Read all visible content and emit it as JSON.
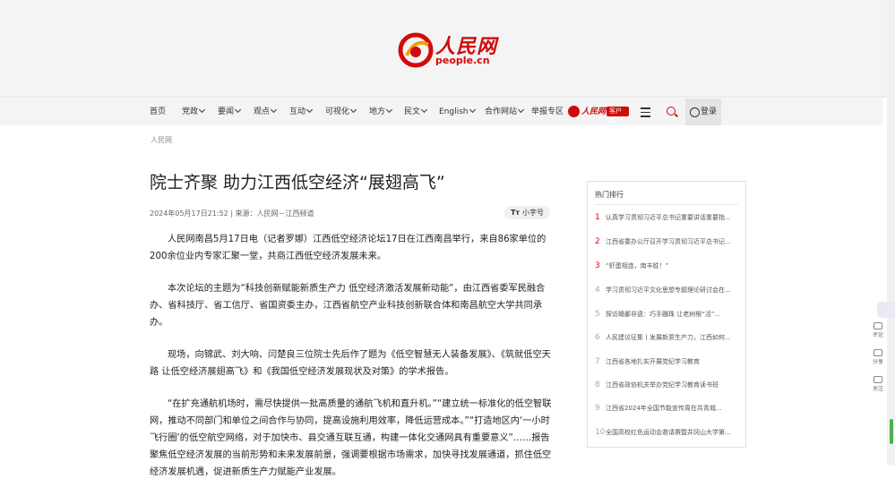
{
  "logo": {
    "cn": "人民网",
    "en": "people.cn"
  },
  "nav": {
    "items": [
      {
        "label": "首页",
        "caret": false
      },
      {
        "label": "党政",
        "caret": true
      },
      {
        "label": "要闻",
        "caret": true
      },
      {
        "label": "观点",
        "caret": true
      },
      {
        "label": "互动",
        "caret": true
      },
      {
        "label": "可视化",
        "caret": true
      },
      {
        "label": "地方",
        "caret": true
      },
      {
        "label": "民文",
        "caret": true
      },
      {
        "label": "English",
        "caret": true
      },
      {
        "label": "合作网站",
        "caret": true
      },
      {
        "label": "举报专区",
        "caret": false
      }
    ],
    "app_name": "人民网+",
    "app_tag": "客户端",
    "login": "登录"
  },
  "breadcrumb": "人民网",
  "article": {
    "title": "院士齐聚 助力江西低空经济“展翅高飞”",
    "meta": "2024年05月17日21:52 | 来源：人民网－江西频道",
    "fontsize_label": "小字号",
    "paragraphs": [
      "人民网南昌5月17日电（记者罗娜）江西低空经济论坛17日在江西南昌举行，来自86家单位的200余位业内专家汇聚一堂，共商江西低空经济发展未来。",
      "本次论坛的主题为“科技创新赋能新质生产力 低空经济激活发展新动能”，由江西省委军民融合办、省科技厅、省工信厅、省国资委主办，江西省航空产业科技创新联合体和南昌航空大学共同承办。",
      "现场，向锦武、刘大响、闫楚良三位院士先后作了题为《低空智慧无人装备发展》、《筑就低空天路 让低空经济展翅高飞》和《我国低空经济发展现状及对策》的学术报告。",
      "“在扩充通航机场时，需尽快提供一批高质量的通航飞机和直升机。”“建立统一标准化的低空智联网，推动不同部门和单位之间合作与协同，提高设施利用效率，降低运营成本。”“打造地区内‘一小时飞行圈’的低空航空网络，对于加快市、县交通互联互通，构建一体化交通网具有重要意义”……报告聚焦低空经济发展的当前形势和未来发展前景，强调要根据市场需求，加快寻找发展通道，抓住低空经济发展机遇，促进新质生产力赋能产业发展。"
    ]
  },
  "hot": {
    "title": "热门排行",
    "items": [
      {
        "num": "1",
        "text": "认真学习贯彻习近平总书记重要讲话重要指..."
      },
      {
        "num": "2",
        "text": "江西省委办公厅召开学习贯彻习近平总书记..."
      },
      {
        "num": "3",
        "text": "“虾蛋相连，南丰胜！”"
      },
      {
        "num": "4",
        "text": "学习贯彻习近平文化思想专题理论研讨会在..."
      },
      {
        "num": "5",
        "text": "探访赣鄱非遗：巧手蹦珠 让老树根“活”..."
      },
      {
        "num": "6",
        "text": "人民建议征集丨发展新质生产力，江西如何..."
      },
      {
        "num": "7",
        "text": "江西省各地扎实开展党纪学习教育"
      },
      {
        "num": "8",
        "text": "江西省政协机关举办党纪学习教育读书班"
      },
      {
        "num": "9",
        "text": "江西省2024年全国节能宣传周在共青城..."
      },
      {
        "num": "10",
        "text": "全国高校红色运动会邀请赛暨井冈山大学第..."
      }
    ]
  },
  "side_tools": [
    {
      "label": "评论"
    },
    {
      "label": "分享"
    },
    {
      "label": "关注"
    }
  ],
  "colors": {
    "brand_red": "#d20a0a",
    "scroll_accent": "#4caf50"
  }
}
